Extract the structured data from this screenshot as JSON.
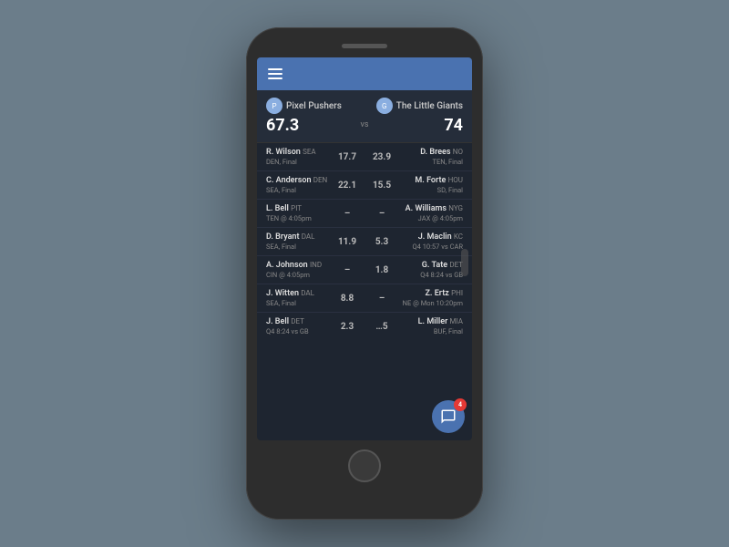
{
  "phone": {
    "topBar": {
      "menu_label": "menu"
    },
    "header": {
      "team_left_name": "Pixel Pushers",
      "team_left_score": "67.3",
      "team_right_name": "The Little Giants",
      "team_right_score": "74",
      "vs_label": "vs"
    },
    "players": [
      {
        "left_name": "R. Wilson",
        "left_team": "SEA",
        "left_status": "DEN, Final",
        "left_score": "17.7",
        "right_name": "D. Brees",
        "right_team": "NO",
        "right_status": "TEN, Final",
        "right_score": "23.9"
      },
      {
        "left_name": "C. Anderson",
        "left_team": "DEN",
        "left_status": "SEA, Final",
        "left_score": "22.1",
        "right_name": "M. Forte",
        "right_team": "HOU",
        "right_status": "SD, Final",
        "right_score": "15.5"
      },
      {
        "left_name": "L. Bell",
        "left_team": "PIT",
        "left_status": "TEN @ 4:05pm",
        "left_score": "–",
        "right_name": "A. Williams",
        "right_team": "NYG",
        "right_status": "JAX @ 4:05pm",
        "right_score": "–"
      },
      {
        "left_name": "D. Bryant",
        "left_team": "DAL",
        "left_status": "SEA, Final",
        "left_score": "11.9",
        "right_name": "J. Maclin",
        "right_team": "KC",
        "right_status": "Q4 10:57 vs CAR",
        "right_score": "5.3"
      },
      {
        "left_name": "A. Johnson",
        "left_team": "IND",
        "left_status": "CIN @ 4:05pm",
        "left_score": "–",
        "right_name": "G. Tate",
        "right_team": "DET",
        "right_status": "Q4 8:24 vs GB",
        "right_score": "1.8"
      },
      {
        "left_name": "J. Witten",
        "left_team": "DAL",
        "left_status": "SEA, Final",
        "left_score": "8.8",
        "right_name": "Z. Ertz",
        "right_team": "PHI",
        "right_status": "NE @ Mon 10:20pm",
        "right_score": "–"
      },
      {
        "left_name": "J. Bell",
        "left_team": "DET",
        "left_status": "Q4 8:24 vs GB",
        "left_score": "2.3",
        "right_name": "L. Miller",
        "right_team": "MIA",
        "right_status": "BUF, Final",
        "right_score": "…5"
      }
    ],
    "chat": {
      "badge_count": "4"
    }
  }
}
